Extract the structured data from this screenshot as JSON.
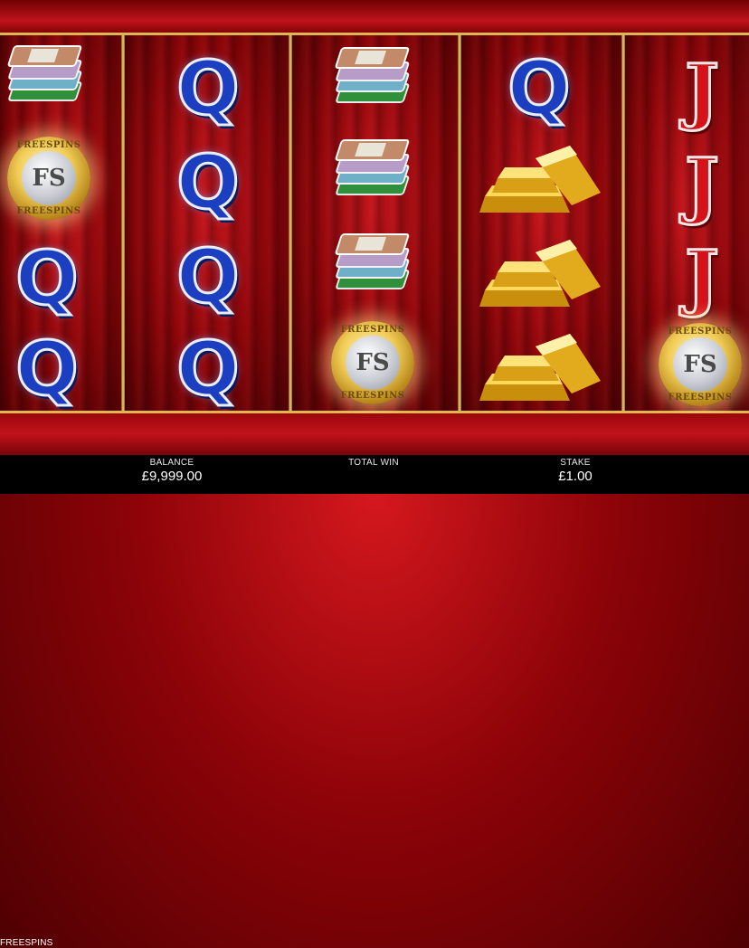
{
  "hud": {
    "balance_label": "BALANCE",
    "balance_value": "£9,999.00",
    "total_win_label": "TOTAL WIN",
    "stake_label": "STAKE",
    "stake_value": "£1.00",
    "mode_text": "FREESPINS"
  },
  "coin": {
    "center": "FS",
    "ring_text": "FREESPINS"
  },
  "reels": [
    [
      "cash-stack",
      "freespins-coin",
      "Q",
      "Q"
    ],
    [
      "Q",
      "Q",
      "Q",
      "Q"
    ],
    [
      "cash-stack",
      "cash-stack",
      "cash-stack",
      "freespins-coin"
    ],
    [
      "Q",
      "gold-bars",
      "gold-bars",
      "gold-bars"
    ],
    [
      "J",
      "J",
      "J",
      "freespins-coin"
    ]
  ],
  "colors": {
    "gold_frame": "#e0b650",
    "reel_red": "#c3151c",
    "q_blue": "#1c3fc2",
    "j_red": "#d5121a"
  }
}
